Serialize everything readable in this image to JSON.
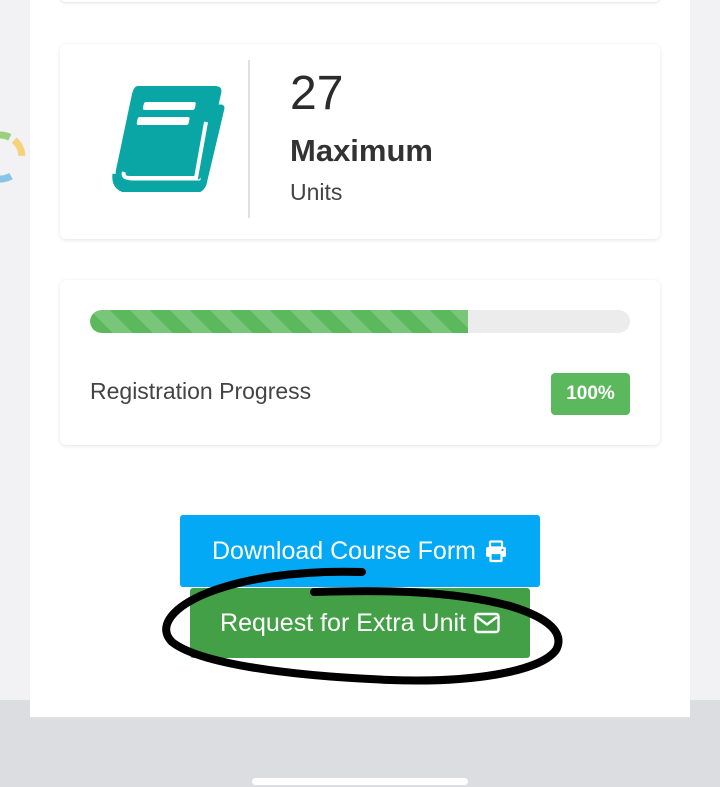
{
  "units": {
    "number": "27",
    "title": "Maximum",
    "subtitle": "Units"
  },
  "progress": {
    "label": "Registration Progress",
    "badge": "100%",
    "fill_fraction": 0.7
  },
  "buttons": {
    "download_label": "Download Course Form",
    "request_label": "Request for Extra Unit"
  },
  "icons": {
    "book": "book-icon",
    "print": "print-icon",
    "envelope": "envelope-icon",
    "spinner": "loading-spinner-icon"
  },
  "colors": {
    "teal_icon": "#0aa5a5",
    "progress_green": "#5cb85c",
    "download_blue": "#03a9f4",
    "request_green": "#43a047",
    "annotation_black": "#000000"
  }
}
